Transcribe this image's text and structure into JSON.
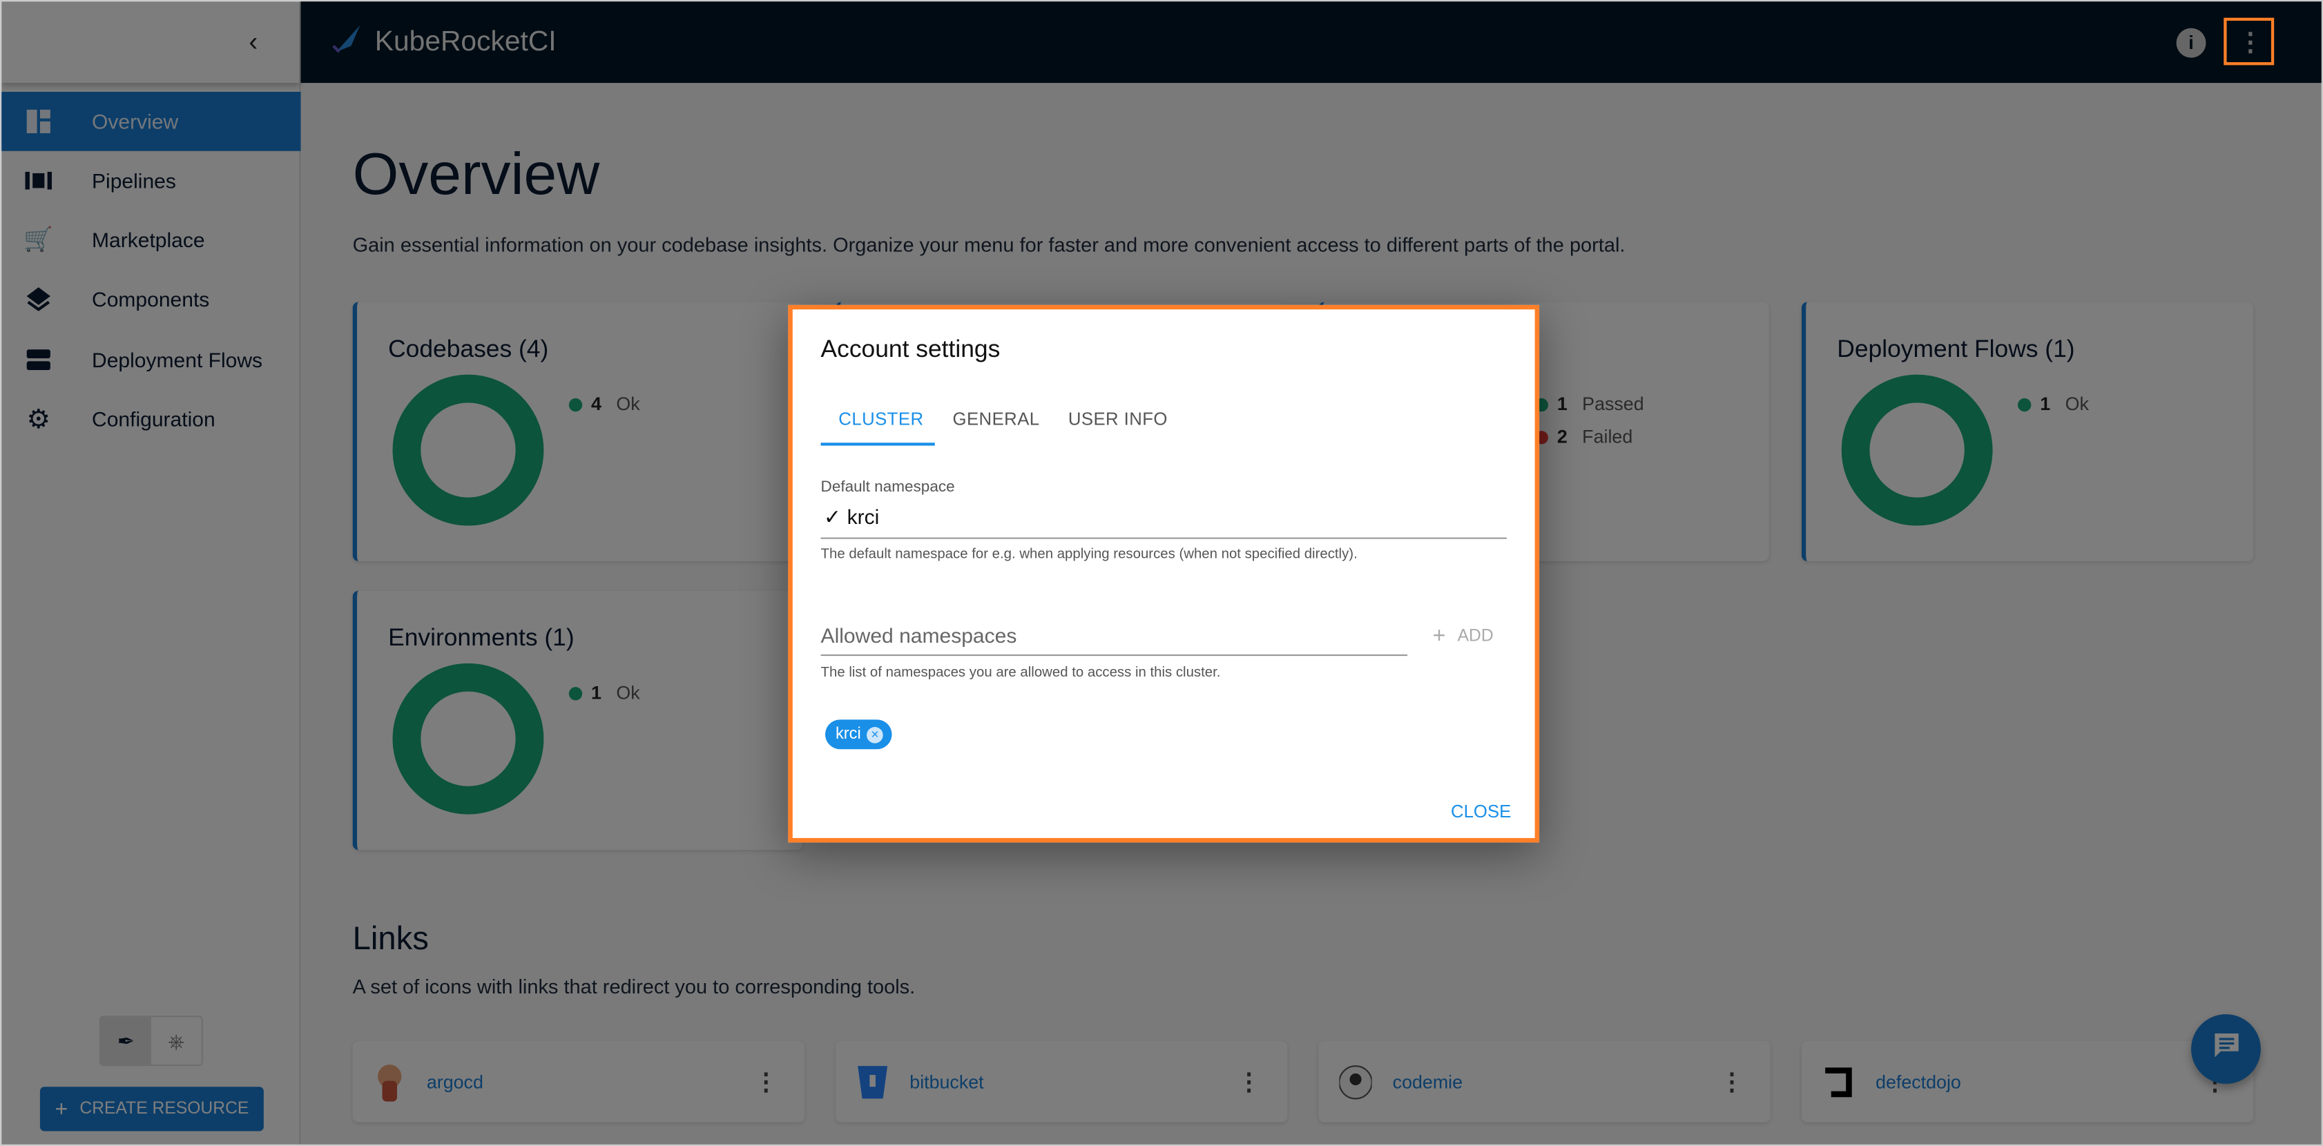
{
  "app": {
    "title": "KubeRocketCI"
  },
  "sidebar": {
    "items": [
      {
        "label": "Overview",
        "icon": "dashboard-icon",
        "active": true
      },
      {
        "label": "Pipelines",
        "icon": "pipelines-icon"
      },
      {
        "label": "Marketplace",
        "icon": "cart-icon"
      },
      {
        "label": "Components",
        "icon": "layers-icon"
      },
      {
        "label": "Deployment Flows",
        "icon": "storage-icon"
      },
      {
        "label": "Configuration",
        "icon": "gear-icon"
      }
    ],
    "create_label": "CREATE RESOURCE"
  },
  "main": {
    "title": "Overview",
    "description": "Gain essential information on your codebase insights. Organize your menu for faster and more convenient access to different parts of the portal.",
    "cards": {
      "codebases": {
        "title": "Codebases (4)",
        "count": "4",
        "status": "Ok"
      },
      "pipelines": {
        "passed_count": "1",
        "passed": "Passed",
        "failed_count": "2",
        "failed": "Failed"
      },
      "deployment_flows": {
        "title": "Deployment Flows (1)",
        "count": "1",
        "status": "Ok"
      },
      "environments": {
        "title": "Environments (1)",
        "count": "1",
        "status": "Ok"
      }
    },
    "links_title": "Links",
    "links_description": "A set of icons with links that redirect you to corresponding tools.",
    "links": [
      {
        "name": "argocd"
      },
      {
        "name": "bitbucket"
      },
      {
        "name": "codemie"
      },
      {
        "name": "defectdojo"
      }
    ]
  },
  "dialog": {
    "title": "Account settings",
    "tabs": [
      {
        "label": "CLUSTER",
        "active": true
      },
      {
        "label": "GENERAL"
      },
      {
        "label": "USER INFO"
      }
    ],
    "default_ns_label": "Default namespace",
    "default_ns_value": "krci",
    "default_ns_hint": "The default namespace for e.g. when applying resources (when not specified directly).",
    "allowed_ns_placeholder": "Allowed namespaces",
    "add_label": "ADD",
    "allowed_ns_hint": "The list of namespaces you are allowed to access in this cluster.",
    "chips": [
      "krci"
    ],
    "close_label": "CLOSE"
  },
  "colors": {
    "accent": "#1a7cd2",
    "ok": "#18a877",
    "failed": "#e53935",
    "header": "#011627",
    "highlight": "#ff7f27"
  }
}
